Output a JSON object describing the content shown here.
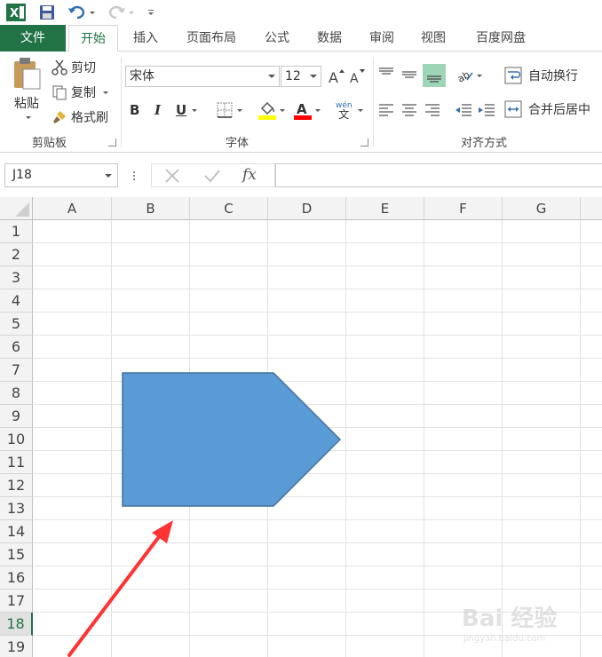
{
  "qat": {
    "app_icon": "excel-logo-icon",
    "save_icon": "save-icon",
    "undo_icon": "undo-icon",
    "redo_icon": "redo-icon",
    "customize_icon": "customize-qat-icon"
  },
  "tabs": [
    {
      "label": "文件"
    },
    {
      "label": "开始"
    },
    {
      "label": "插入"
    },
    {
      "label": "页面布局"
    },
    {
      "label": "公式"
    },
    {
      "label": "数据"
    },
    {
      "label": "审阅"
    },
    {
      "label": "视图"
    },
    {
      "label": "百度网盘"
    }
  ],
  "clipboard": {
    "paste_label": "粘贴",
    "cut_label": "剪切",
    "copy_label": "复制",
    "format_painter_label": "格式刷",
    "group_label": "剪贴板"
  },
  "font": {
    "font_name": "宋体",
    "font_size": "12",
    "bold": "B",
    "italic": "I",
    "underline": "U",
    "phonetic_top": "wén",
    "phonetic_bottom": "文",
    "group_label": "字体",
    "fill_color": "#ffff00",
    "font_color": "#ff0000"
  },
  "alignment": {
    "wrap_text_label": "自动换行",
    "merge_center_label": "合并后居中",
    "group_label": "对齐方式"
  },
  "formula_bar": {
    "name_box": "J18",
    "cancel_icon": "close-icon",
    "enter_icon": "check-icon",
    "fx": "fx",
    "value": ""
  },
  "sheet": {
    "columns": [
      "A",
      "B",
      "C",
      "D",
      "E",
      "F",
      "G"
    ],
    "rows": [
      "1",
      "2",
      "3",
      "4",
      "5",
      "6",
      "7",
      "8",
      "9",
      "10",
      "11",
      "12",
      "13",
      "14",
      "15",
      "16",
      "17",
      "18",
      "19"
    ],
    "selected_row": "18",
    "shape_color": "#5b9bd5",
    "arrow_color": "#ff3333",
    "shape_name": "pentagon-arrow-shape"
  },
  "watermark": {
    "brand": "Bai 经验",
    "url": "jingyan.baidu.com"
  }
}
